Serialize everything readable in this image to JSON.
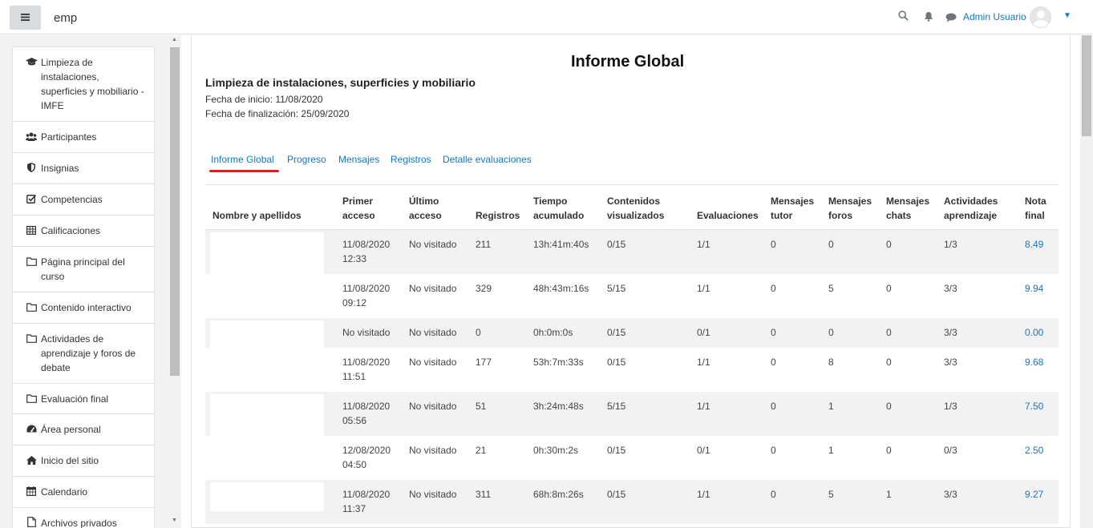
{
  "navbar": {
    "brand": "emp",
    "user_name": "Admin Usuario",
    "icons": [
      "menu-icon",
      "search-icon",
      "bell-icon",
      "chat-icon",
      "chevron-down-icon"
    ]
  },
  "sidebar": {
    "course_items": [
      {
        "label": "Limpieza de instalaciones, superficies y mobiliario - IMFE",
        "icon": "graduation-cap-icon"
      },
      {
        "label": "Participantes",
        "icon": "users-icon"
      },
      {
        "label": "Insignias",
        "icon": "shield-icon"
      },
      {
        "label": "Competencias",
        "icon": "check-square-icon"
      },
      {
        "label": "Calificaciones",
        "icon": "table-icon"
      }
    ],
    "section_items": [
      {
        "label": "Página principal del curso",
        "icon": "folder-icon"
      },
      {
        "label": "Contenido interactivo",
        "icon": "folder-icon"
      },
      {
        "label": "Actividades de aprendizaje y foros de debate",
        "icon": "folder-icon"
      },
      {
        "label": "Evaluación final",
        "icon": "folder-icon"
      }
    ],
    "site_items": [
      {
        "label": "Área personal",
        "icon": "dashboard-icon"
      },
      {
        "label": "Inicio del sitio",
        "icon": "home-icon"
      },
      {
        "label": "Calendario",
        "icon": "calendar-icon"
      },
      {
        "label": "Archivos privados",
        "icon": "file-icon"
      }
    ]
  },
  "main": {
    "title": "Informe Global",
    "course_name": "Limpieza de instalaciones, superficies y mobiliario",
    "start_date": "Fecha de inicio: 11/08/2020",
    "end_date": "Fecha de finalización: 25/09/2020",
    "tabs": [
      "Informe Global",
      "Progreso",
      "Mensajes",
      "Registros",
      "Detalle evaluaciones"
    ],
    "active_tab": "Informe Global"
  },
  "table": {
    "headers": [
      [
        "Nombre y apellidos"
      ],
      [
        "Primer",
        "acceso"
      ],
      [
        "Último",
        "acceso"
      ],
      [
        "Registros"
      ],
      [
        "Tiempo",
        "acumulado"
      ],
      [
        "Contenidos",
        "visualizados"
      ],
      [
        "Evaluaciones"
      ],
      [
        "Mensajes",
        "tutor"
      ],
      [
        "Mensajes",
        "foros"
      ],
      [
        "Mensajes",
        "chats"
      ],
      [
        "Actividades",
        "aprendizaje"
      ],
      [
        "Nota",
        "final"
      ]
    ],
    "rows": [
      {
        "primer": [
          "11/08/2020",
          "12:33"
        ],
        "ultimo": "No visitado",
        "registros": "211",
        "tiempo": "13h:41m:40s",
        "contenidos": "0/15",
        "evaluaciones": "1/1",
        "tutor": "0",
        "foros": "0",
        "chats": "0",
        "actividades": "1/3",
        "nota": "8.49"
      },
      {
        "primer": [
          "11/08/2020",
          "09:12"
        ],
        "ultimo": "No visitado",
        "registros": "329",
        "tiempo": "48h:43m:16s",
        "contenidos": "5/15",
        "evaluaciones": "1/1",
        "tutor": "0",
        "foros": "5",
        "chats": "0",
        "actividades": "3/3",
        "nota": "9.94"
      },
      {
        "primer": [
          "No visitado"
        ],
        "ultimo": "No visitado",
        "registros": "0",
        "tiempo": "0h:0m:0s",
        "contenidos": "0/15",
        "evaluaciones": "0/1",
        "tutor": "0",
        "foros": "0",
        "chats": "0",
        "actividades": "3/3",
        "nota": "0.00"
      },
      {
        "primer": [
          "11/08/2020",
          "11:51"
        ],
        "ultimo": "No visitado",
        "registros": "177",
        "tiempo": "53h:7m:33s",
        "contenidos": "0/15",
        "evaluaciones": "1/1",
        "tutor": "0",
        "foros": "8",
        "chats": "0",
        "actividades": "3/3",
        "nota": "9.68"
      },
      {
        "primer": [
          "11/08/2020",
          "05:56"
        ],
        "ultimo": "No visitado",
        "registros": "51",
        "tiempo": "3h:24m:48s",
        "contenidos": "5/15",
        "evaluaciones": "1/1",
        "tutor": "0",
        "foros": "1",
        "chats": "0",
        "actividades": "1/3",
        "nota": "7.50"
      },
      {
        "primer": [
          "12/08/2020",
          "04:50"
        ],
        "ultimo": "No visitado",
        "registros": "21",
        "tiempo": "0h:30m:2s",
        "contenidos": "0/15",
        "evaluaciones": "0/1",
        "tutor": "0",
        "foros": "1",
        "chats": "0",
        "actividades": "0/3",
        "nota": "2.50"
      },
      {
        "primer": [
          "11/08/2020",
          "11:37"
        ],
        "ultimo": "No visitado",
        "registros": "311",
        "tiempo": "68h:8m:26s",
        "contenidos": "0/15",
        "evaluaciones": "1/1",
        "tutor": "0",
        "foros": "5",
        "chats": "1",
        "actividades": "3/3",
        "nota": "9.27"
      }
    ]
  },
  "colors": {
    "link": "#1177d1",
    "active_tab_underline": "#e31b23",
    "striped_row": "#f2f2f2",
    "drawer_bg": "#f2f2f2"
  }
}
